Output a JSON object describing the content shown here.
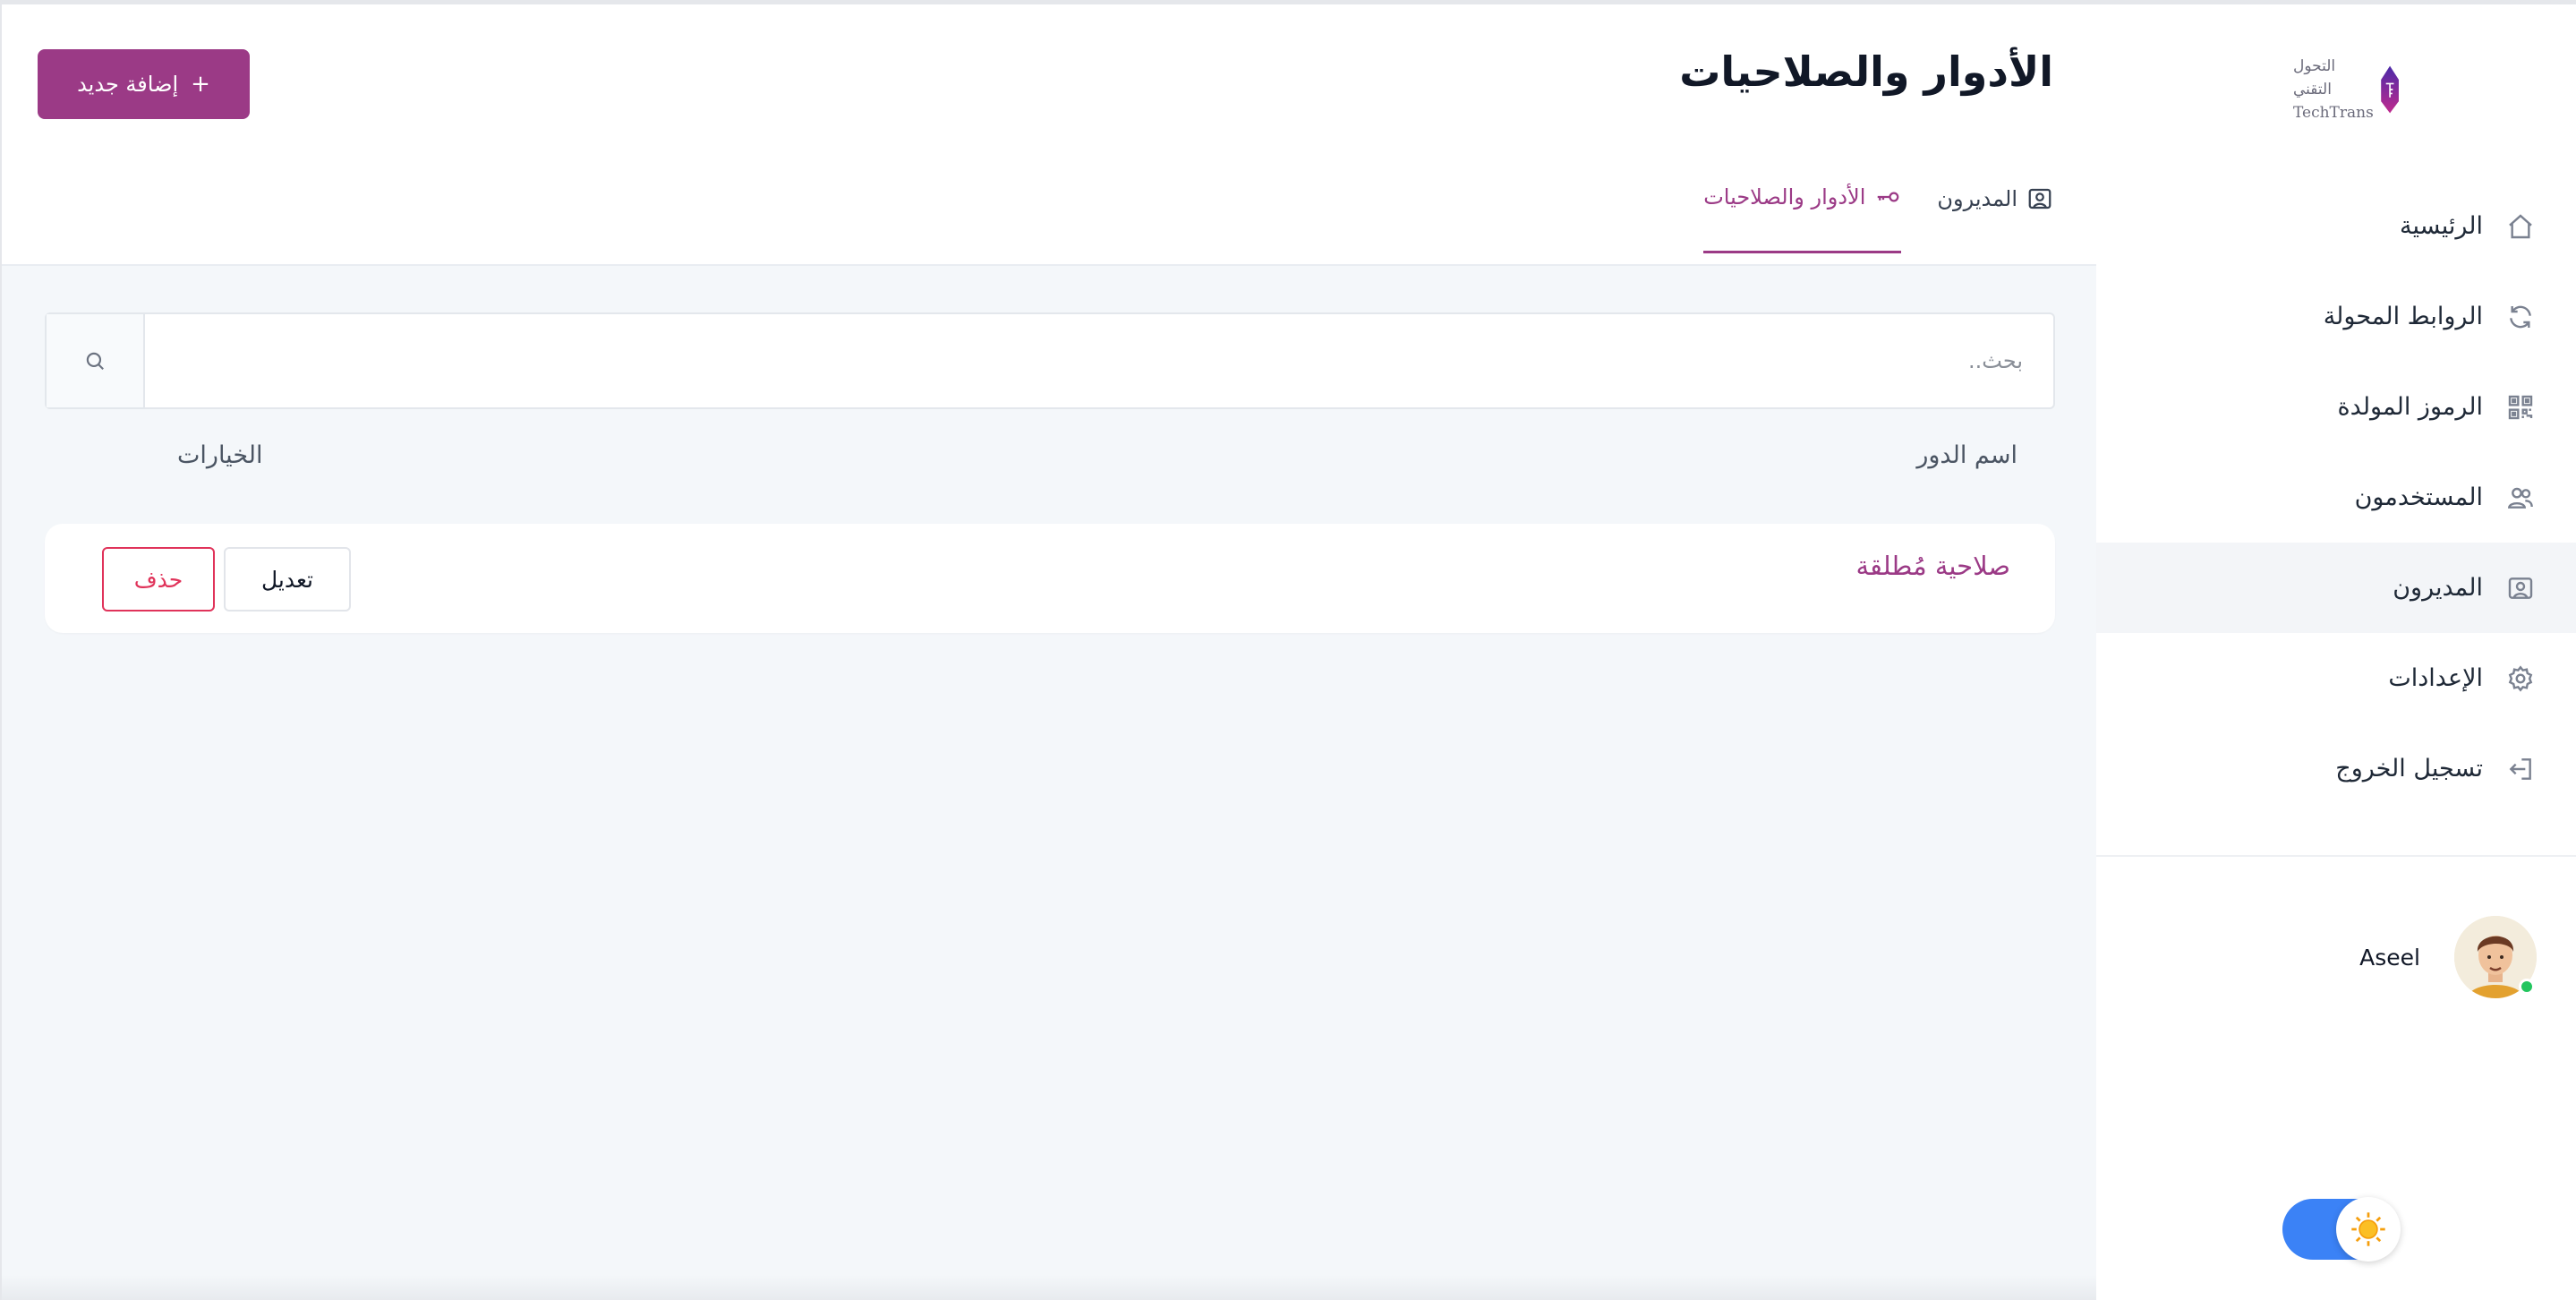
{
  "sidebar": {
    "logo": {
      "arabic_text": "التحول التقني",
      "english_text": "TechTrans"
    },
    "items": [
      {
        "label": "الرئيسية",
        "icon": "home-icon",
        "active": false
      },
      {
        "label": "الروابط المحولة",
        "icon": "refresh-icon",
        "active": false
      },
      {
        "label": "الرموز المولدة",
        "icon": "qr-code-icon",
        "active": false
      },
      {
        "label": "المستخدمون",
        "icon": "users-icon",
        "active": false
      },
      {
        "label": "المديرون",
        "icon": "admin-badge-icon",
        "active": true
      },
      {
        "label": "الإعدادات",
        "icon": "gear-icon",
        "active": false
      },
      {
        "label": "تسجيل الخروج",
        "icon": "logout-icon",
        "active": false
      }
    ],
    "user": {
      "name": "Aseel",
      "status": "online"
    },
    "theme_toggle": {
      "mode": "light",
      "icon": "sun-icon"
    }
  },
  "header": {
    "title": "الأدوار والصلاحيات",
    "add_button_label": "إضافة جديد",
    "add_button_icon": "plus-icon",
    "tabs": [
      {
        "label": "المديرون",
        "icon": "admin-badge-icon",
        "active": false
      },
      {
        "label": "الأدوار والصلاحيات",
        "icon": "key-icon",
        "active": true
      }
    ]
  },
  "search": {
    "placeholder": "بحث..",
    "value": ""
  },
  "table": {
    "columns": {
      "role_name": "اسم الدور",
      "options": "الخيارات"
    },
    "rows": [
      {
        "role_name": "صلاحية مُطلقة",
        "edit_label": "تعديل",
        "delete_label": "حذف"
      }
    ]
  },
  "colors": {
    "accent": "#9b3a86",
    "danger": "#e0335a",
    "toggle": "#3b82f6",
    "content_bg": "#f4f7fa"
  }
}
